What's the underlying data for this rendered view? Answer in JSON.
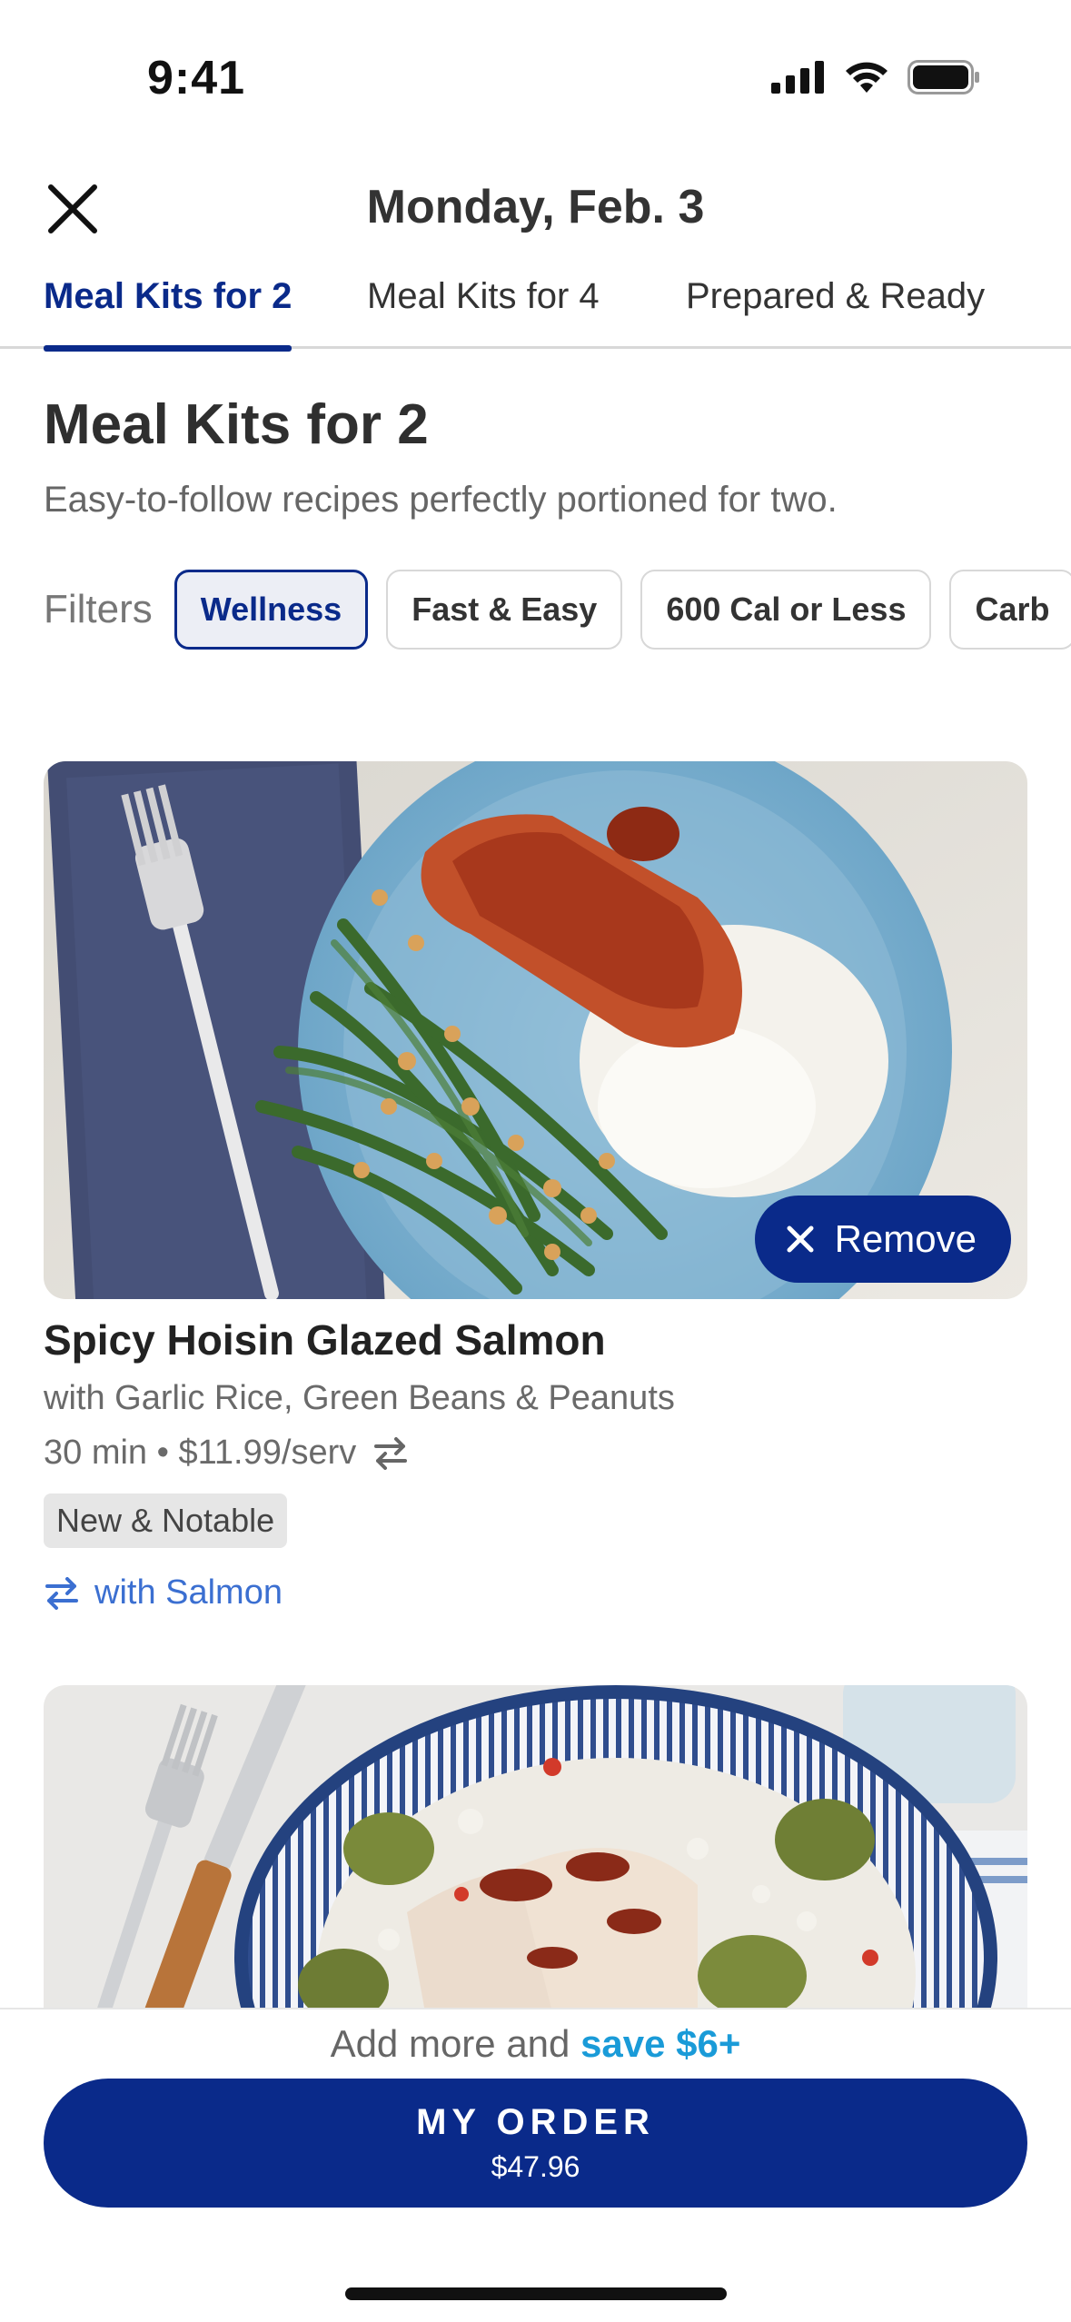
{
  "status": {
    "time": "9:41"
  },
  "header": {
    "title": "Monday, Feb. 3"
  },
  "tabs": [
    {
      "label": "Meal Kits for 2",
      "active": true
    },
    {
      "label": "Meal Kits for 4",
      "active": false
    },
    {
      "label": "Prepared & Ready",
      "active": false
    }
  ],
  "section": {
    "title": "Meal Kits for 2",
    "subtitle": "Easy-to-follow recipes perfectly portioned for two."
  },
  "filters": {
    "label": "Filters",
    "chips": [
      {
        "label": "Wellness",
        "selected": true
      },
      {
        "label": "Fast & Easy",
        "selected": false
      },
      {
        "label": "600 Cal or Less",
        "selected": false
      },
      {
        "label": "Carb",
        "selected": false
      }
    ]
  },
  "meals": [
    {
      "title": "Spicy Hoisin Glazed Salmon",
      "subtitle": "with Garlic Rice, Green Beans & Peanuts",
      "meta": "30 min • $11.99/serv",
      "badge": "New & Notable",
      "swap": "with Salmon",
      "remove_label": "Remove"
    }
  ],
  "bottom": {
    "promo_prefix": "Add more and",
    "promo_save": "save $6+",
    "order_label": "MY ORDER",
    "order_total": "$47.96"
  },
  "colors": {
    "brand": "#0a2a8a",
    "accent": "#1a9bd8",
    "link": "#3b6fd1"
  }
}
